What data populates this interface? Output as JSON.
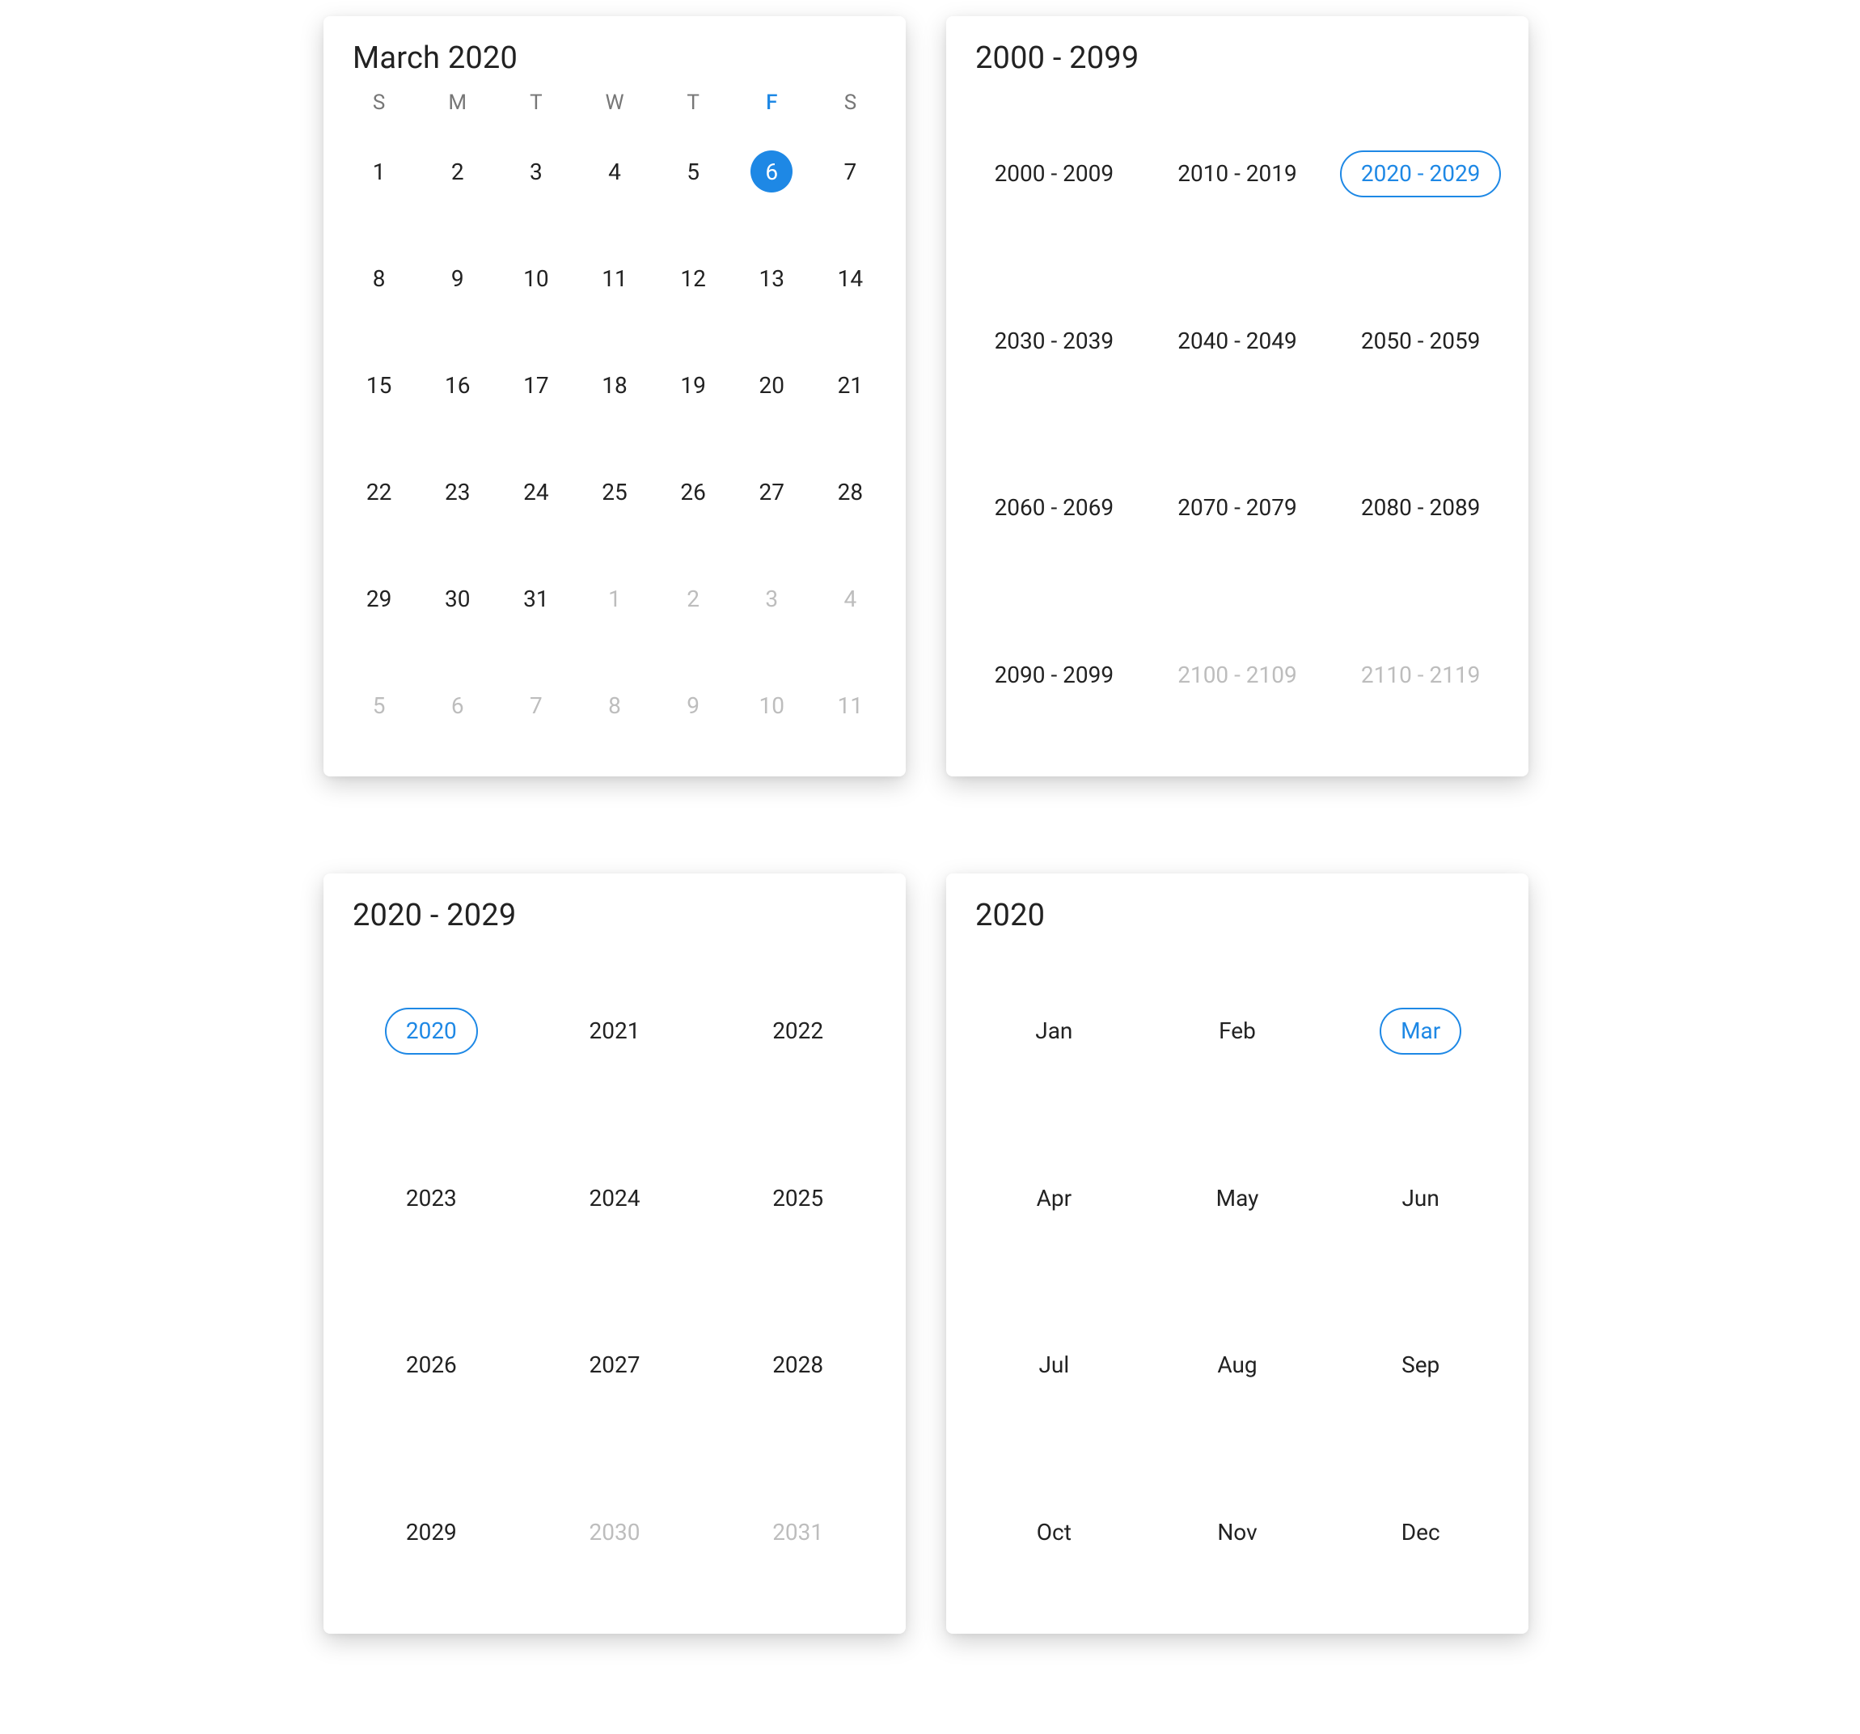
{
  "accent": "#1e88e5",
  "month_panel": {
    "title": "March 2020",
    "weekdays": [
      "S",
      "M",
      "T",
      "W",
      "T",
      "F",
      "S"
    ],
    "current_weekday_index": 5,
    "selected_day": 6,
    "days": [
      {
        "n": 1,
        "outside": false
      },
      {
        "n": 2,
        "outside": false
      },
      {
        "n": 3,
        "outside": false
      },
      {
        "n": 4,
        "outside": false
      },
      {
        "n": 5,
        "outside": false
      },
      {
        "n": 6,
        "outside": false,
        "selected": true
      },
      {
        "n": 7,
        "outside": false
      },
      {
        "n": 8,
        "outside": false
      },
      {
        "n": 9,
        "outside": false
      },
      {
        "n": 10,
        "outside": false
      },
      {
        "n": 11,
        "outside": false
      },
      {
        "n": 12,
        "outside": false
      },
      {
        "n": 13,
        "outside": false
      },
      {
        "n": 14,
        "outside": false
      },
      {
        "n": 15,
        "outside": false
      },
      {
        "n": 16,
        "outside": false
      },
      {
        "n": 17,
        "outside": false
      },
      {
        "n": 18,
        "outside": false
      },
      {
        "n": 19,
        "outside": false
      },
      {
        "n": 20,
        "outside": false
      },
      {
        "n": 21,
        "outside": false
      },
      {
        "n": 22,
        "outside": false
      },
      {
        "n": 23,
        "outside": false
      },
      {
        "n": 24,
        "outside": false
      },
      {
        "n": 25,
        "outside": false
      },
      {
        "n": 26,
        "outside": false
      },
      {
        "n": 27,
        "outside": false
      },
      {
        "n": 28,
        "outside": false
      },
      {
        "n": 29,
        "outside": false
      },
      {
        "n": 30,
        "outside": false
      },
      {
        "n": 31,
        "outside": false
      },
      {
        "n": 1,
        "outside": true
      },
      {
        "n": 2,
        "outside": true
      },
      {
        "n": 3,
        "outside": true
      },
      {
        "n": 4,
        "outside": true
      },
      {
        "n": 5,
        "outside": true
      },
      {
        "n": 6,
        "outside": true
      },
      {
        "n": 7,
        "outside": true
      },
      {
        "n": 8,
        "outside": true
      },
      {
        "n": 9,
        "outside": true
      },
      {
        "n": 10,
        "outside": true
      },
      {
        "n": 11,
        "outside": true
      }
    ]
  },
  "century_panel": {
    "title": "2000 - 2099",
    "selected": "2020 - 2029",
    "ranges": [
      {
        "label": "2000 - 2009"
      },
      {
        "label": "2010 - 2019"
      },
      {
        "label": "2020 - 2029",
        "selected": true
      },
      {
        "label": "2030 - 2039"
      },
      {
        "label": "2040 - 2049"
      },
      {
        "label": "2050 - 2059"
      },
      {
        "label": "2060 - 2069"
      },
      {
        "label": "2070 - 2079"
      },
      {
        "label": "2080 - 2089"
      },
      {
        "label": "2090 - 2099"
      },
      {
        "label": "2100 - 2109",
        "disabled": true
      },
      {
        "label": "2110 - 2119",
        "disabled": true
      }
    ]
  },
  "decade_panel": {
    "title": "2020 - 2029",
    "selected": "2020",
    "years": [
      {
        "label": "2020",
        "selected": true
      },
      {
        "label": "2021"
      },
      {
        "label": "2022"
      },
      {
        "label": "2023"
      },
      {
        "label": "2024"
      },
      {
        "label": "2025"
      },
      {
        "label": "2026"
      },
      {
        "label": "2027"
      },
      {
        "label": "2028"
      },
      {
        "label": "2029"
      },
      {
        "label": "2030",
        "disabled": true
      },
      {
        "label": "2031",
        "disabled": true
      }
    ]
  },
  "year_panel": {
    "title": "2020",
    "selected": "Mar",
    "months": [
      {
        "label": "Jan"
      },
      {
        "label": "Feb"
      },
      {
        "label": "Mar",
        "selected": true
      },
      {
        "label": "Apr"
      },
      {
        "label": "May"
      },
      {
        "label": "Jun"
      },
      {
        "label": "Jul"
      },
      {
        "label": "Aug"
      },
      {
        "label": "Sep"
      },
      {
        "label": "Oct"
      },
      {
        "label": "Nov"
      },
      {
        "label": "Dec"
      }
    ]
  }
}
